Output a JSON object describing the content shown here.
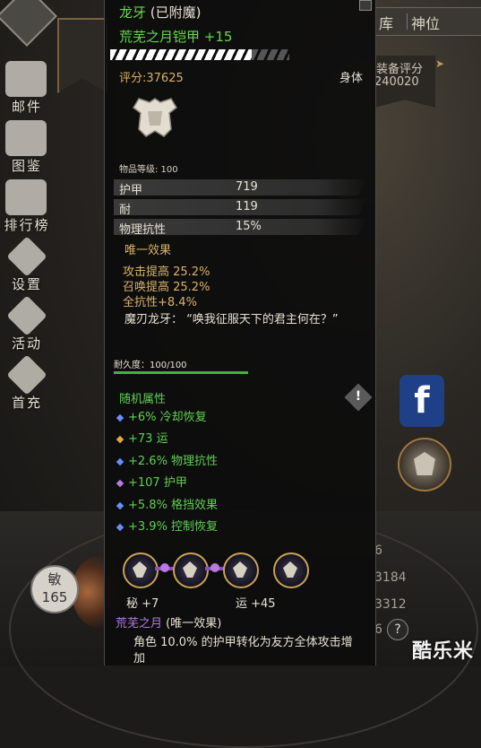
{
  "sidebar": {
    "items": [
      {
        "label": "邮件",
        "icon": "mail-icon"
      },
      {
        "label": "图鉴",
        "icon": "book-icon"
      },
      {
        "label": "排行榜",
        "icon": "ranking-icon"
      },
      {
        "label": "设置",
        "icon": "gear-icon"
      },
      {
        "label": "活动",
        "icon": "activity-icon"
      },
      {
        "label": "首充",
        "icon": "first-recharge-icon"
      }
    ]
  },
  "right": {
    "tabs": [
      "库",
      "神位"
    ],
    "score_label": "装备评分",
    "score_value": "240020",
    "numbers": [
      "6",
      "3184",
      "3312",
      "6"
    ],
    "help": "?",
    "facebook": "f"
  },
  "bottom_left": {
    "stat_label": "敏",
    "stat_value": "165"
  },
  "watermark": "酷乐米",
  "tooltip": {
    "name": "龙牙",
    "enchant_tag": "(已附魔)",
    "full_title": "荒芜之月铠甲 +15",
    "score": "评分:37625",
    "slot": "身体",
    "item_level": "物品等级: 100",
    "stats": [
      {
        "name": "护甲",
        "value": "719"
      },
      {
        "name": "耐",
        "value": "119"
      },
      {
        "name": "物理抗性",
        "value": "15%"
      }
    ],
    "unique_title": "唯一效果",
    "unique_lines": [
      "攻击提高 25.2%",
      "召唤提高 25.2%",
      "全抗性+8.4%"
    ],
    "quote": "魔刃龙牙： “唤我征服天下的君主何在？”",
    "durability": "耐久度：100/100",
    "durability_fraction": 1.0,
    "random_title": "随机属性",
    "random_affixes": [
      {
        "text": "+6% 冷却恢复",
        "color": "#6b8cff"
      },
      {
        "text": "+73 运",
        "color": "#e6a93a"
      },
      {
        "text": "+2.6% 物理抗性",
        "color": "#6b8cff"
      },
      {
        "text": "+107 护甲",
        "color": "#b77ae0"
      },
      {
        "text": "+5.8% 格挡效果",
        "color": "#6b8cff"
      },
      {
        "text": "+3.9% 控制恢复",
        "color": "#6b8cff"
      }
    ],
    "socket_labels": [
      "秘 +7",
      "运 +45"
    ],
    "set_name": "荒芜之月",
    "set_tag": "(唯一效果)",
    "set_desc": "角色 10.0% 的护甲转化为友方全体攻击增加"
  }
}
